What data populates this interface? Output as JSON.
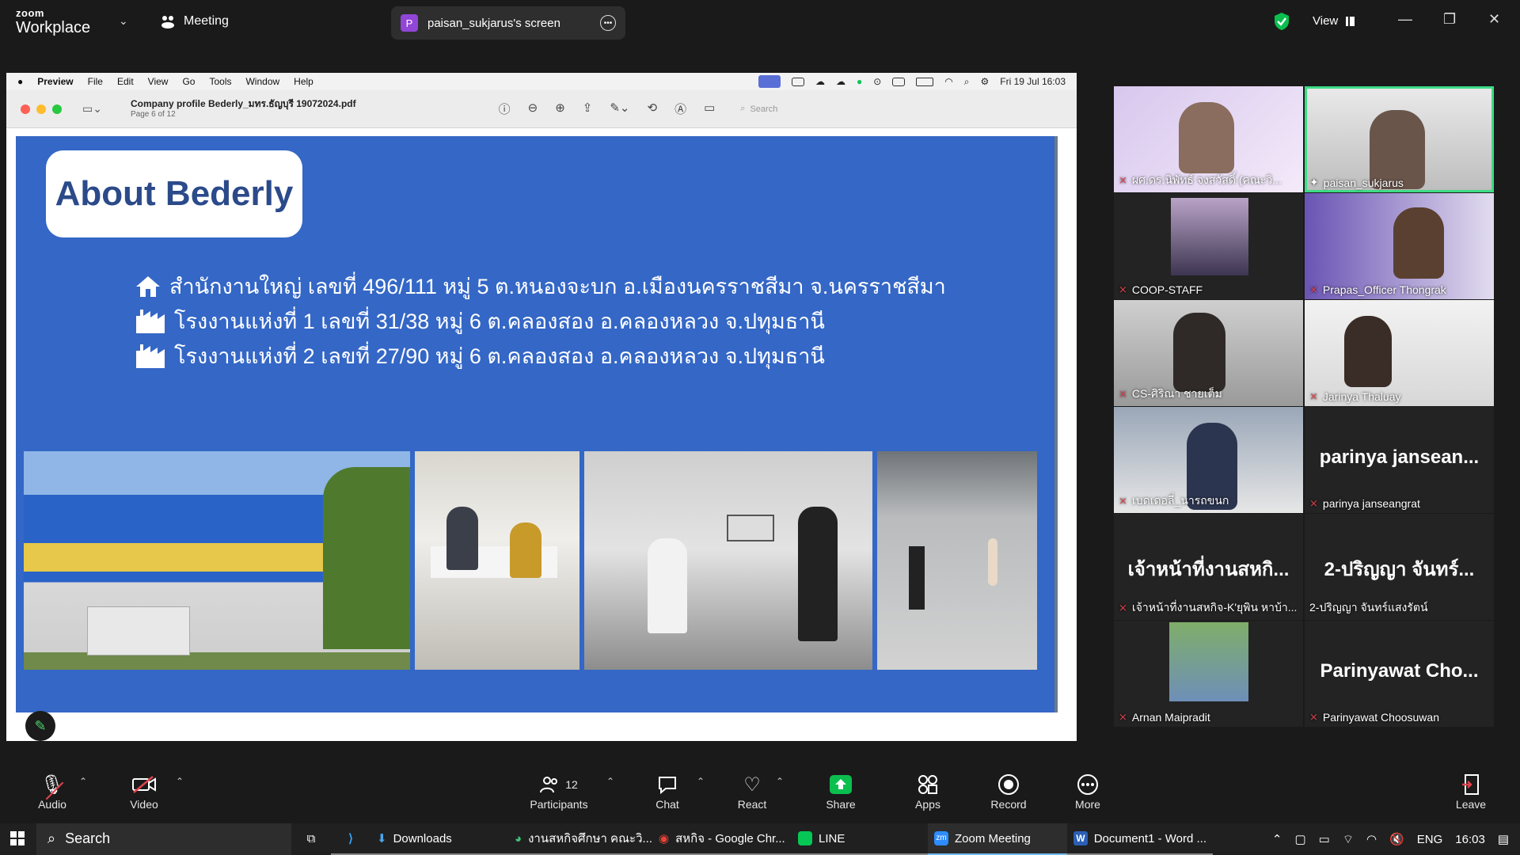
{
  "zoom": {
    "logo_small": "zoom",
    "logo_big": "Workplace",
    "meeting_label": "Meeting",
    "share_badge": "P",
    "share_title": "paisan_sukjarus's screen",
    "view_label": "View"
  },
  "mac": {
    "app": "Preview",
    "menus": [
      "File",
      "Edit",
      "View",
      "Go",
      "Tools",
      "Window",
      "Help"
    ],
    "clock": "Fri 19 Jul  16:03"
  },
  "preview": {
    "doc_title": "Company profile Bederly_มทร.ธัญบุรี 19072024.pdf",
    "page_info": "Page 6 of 12",
    "search_placeholder": "Search"
  },
  "slide": {
    "title": "About Bederly",
    "lines": [
      "สำนักงานใหญ่ เลขที่ 496/111 หมู่ 5 ต.หนองจะบก อ.เมืองนครราชสีมา จ.นครราชสีมา",
      "โรงงานแห่งที่ 1 เลขที่ 31/38 หมู่ 6 ต.คลองสอง อ.คลองหลวง จ.ปทุมธานี",
      "โรงงานแห่งที่ 2 เลขที่ 27/90 หมู่ 6 ต.คลองสอง อ.คลองหลวง จ.ปทุมธานี"
    ]
  },
  "participants": [
    {
      "name": "ผศ.ดร.นิพัทธ์ จงสวัสดิ์ (คณะวิ...",
      "big": ""
    },
    {
      "name": "paisan_sukjarus",
      "big": ""
    },
    {
      "name": "COOP-STAFF",
      "big": ""
    },
    {
      "name": "Prapas_Officer Thongrak",
      "big": ""
    },
    {
      "name": "CS-ศิริณา ชายเต็ม",
      "big": ""
    },
    {
      "name": "Jarinya Thaluay",
      "big": ""
    },
    {
      "name": "เบดเดอลี่_นารถขนก",
      "big": ""
    },
    {
      "name": "parinya janseangrat",
      "big": "parinya  jansean..."
    },
    {
      "name": "เจ้าหน้าที่งานสหกิจ-K'ยุพิน หาบ้า...",
      "big": "เจ้าหน้าที่งานสหกิ..."
    },
    {
      "name": "2-ปริญญา จันทร์แสงรัตน์",
      "big": "2-ปริญญา  จันทร์..."
    },
    {
      "name": "Arnan Maipradit",
      "big": ""
    },
    {
      "name": "Parinyawat Choosuwan",
      "big": "Parinyawat  Cho..."
    }
  ],
  "controls": {
    "audio": "Audio",
    "video": "Video",
    "participants": "Participants",
    "participants_count": "12",
    "chat": "Chat",
    "react": "React",
    "share": "Share",
    "apps": "Apps",
    "record": "Record",
    "more": "More",
    "leave": "Leave"
  },
  "taskbar": {
    "search": "Search",
    "items": [
      "Downloads",
      "งานสหกิจศึกษา คณะวิ...",
      "สหกิจ - Google Chr...",
      "LINE",
      "Zoom Meeting",
      "Document1 - Word ..."
    ],
    "lang": "ENG",
    "time": "16:03"
  },
  "colors": {
    "slide_bg": "#3467c6",
    "title_text": "#2b4a8a",
    "active_speaker_border": "#3ddc84",
    "share_green": "#0bbf4f",
    "mic_off": "#e0424d"
  }
}
